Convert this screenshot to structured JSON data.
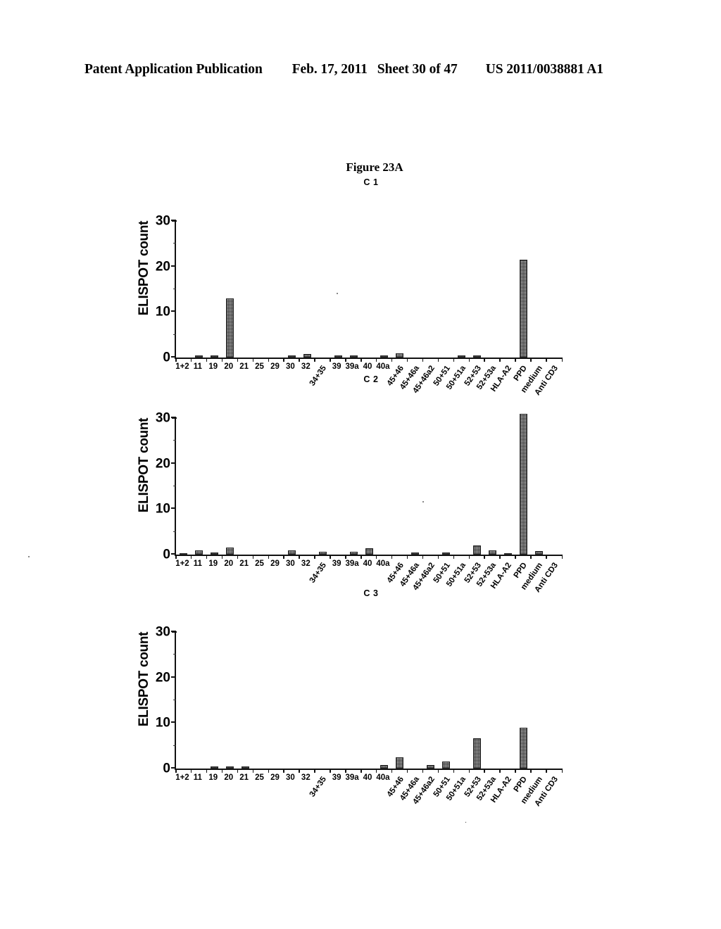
{
  "header": {
    "publication": "Patent Application Publication",
    "date": "Feb. 17, 2011",
    "sheet": "Sheet 30 of 47",
    "number": "US 2011/0038881 A1"
  },
  "figure": {
    "title": "Figure 23A"
  },
  "chart_data": [
    {
      "type": "bar",
      "title": "C 1",
      "xlabel": "",
      "ylabel": "ELISPOT count",
      "ylim": [
        0,
        30
      ],
      "yticks": [
        0,
        10,
        20,
        30
      ],
      "grid": false,
      "legend": "none",
      "categories": [
        "1+2",
        "11",
        "19",
        "20",
        "21",
        "25",
        "29",
        "30",
        "32",
        "34+35",
        "39",
        "39a",
        "40",
        "40a",
        "45+46",
        "45+46a",
        "45+46a2",
        "50+51",
        "50+51a",
        "52+53",
        "52+53a",
        "HLA-A2",
        "PPD",
        "medium",
        "Anti CD3"
      ],
      "values": [
        0,
        0.4,
        0.5,
        13,
        0,
        0,
        0,
        0.4,
        0.8,
        0,
        0.5,
        0.5,
        0,
        0.4,
        1.0,
        0,
        0,
        0,
        0.4,
        0.5,
        0,
        0,
        21.5,
        0,
        0
      ]
    },
    {
      "type": "bar",
      "title": "C 2",
      "xlabel": "",
      "ylabel": "ELISPOT count",
      "ylim": [
        0,
        30
      ],
      "yticks": [
        0,
        10,
        20,
        30
      ],
      "grid": false,
      "legend": "none",
      "categories": [
        "1+2",
        "11",
        "19",
        "20",
        "21",
        "25",
        "29",
        "30",
        "32",
        "34+35",
        "39",
        "39a",
        "40",
        "40a",
        "45+46",
        "45+46a",
        "45+46a2",
        "50+51",
        "50+51a",
        "52+53",
        "52+53a",
        "HLA-A2",
        "PPD",
        "medium",
        "Anti CD3"
      ],
      "values": [
        0.2,
        1.0,
        0.5,
        1.5,
        0,
        0,
        0,
        0.9,
        0,
        0.6,
        0,
        0.6,
        1.4,
        0,
        0,
        0.5,
        0,
        0.5,
        0,
        2.0,
        1.0,
        0.3,
        31,
        0.8,
        0
      ]
    },
    {
      "type": "bar",
      "title": "C 3",
      "xlabel": "",
      "ylabel": "ELISPOT count",
      "ylim": [
        0,
        30
      ],
      "yticks": [
        0,
        10,
        20,
        30
      ],
      "grid": false,
      "legend": "none",
      "categories": [
        "1+2",
        "11",
        "19",
        "20",
        "21",
        "25",
        "29",
        "30",
        "32",
        "34+35",
        "39",
        "39a",
        "40",
        "40a",
        "45+46",
        "45+46a",
        "45+46a2",
        "50+51",
        "50+51a",
        "52+53",
        "52+53a",
        "HLA-A2",
        "PPD",
        "medium",
        "Anti CD3"
      ],
      "values": [
        0,
        0,
        0.5,
        0.5,
        0.4,
        0,
        0,
        0,
        0,
        0,
        0,
        0,
        0,
        0.8,
        2.5,
        0,
        0.7,
        1.5,
        0,
        6.7,
        0,
        0,
        9.0,
        0,
        0
      ]
    }
  ]
}
